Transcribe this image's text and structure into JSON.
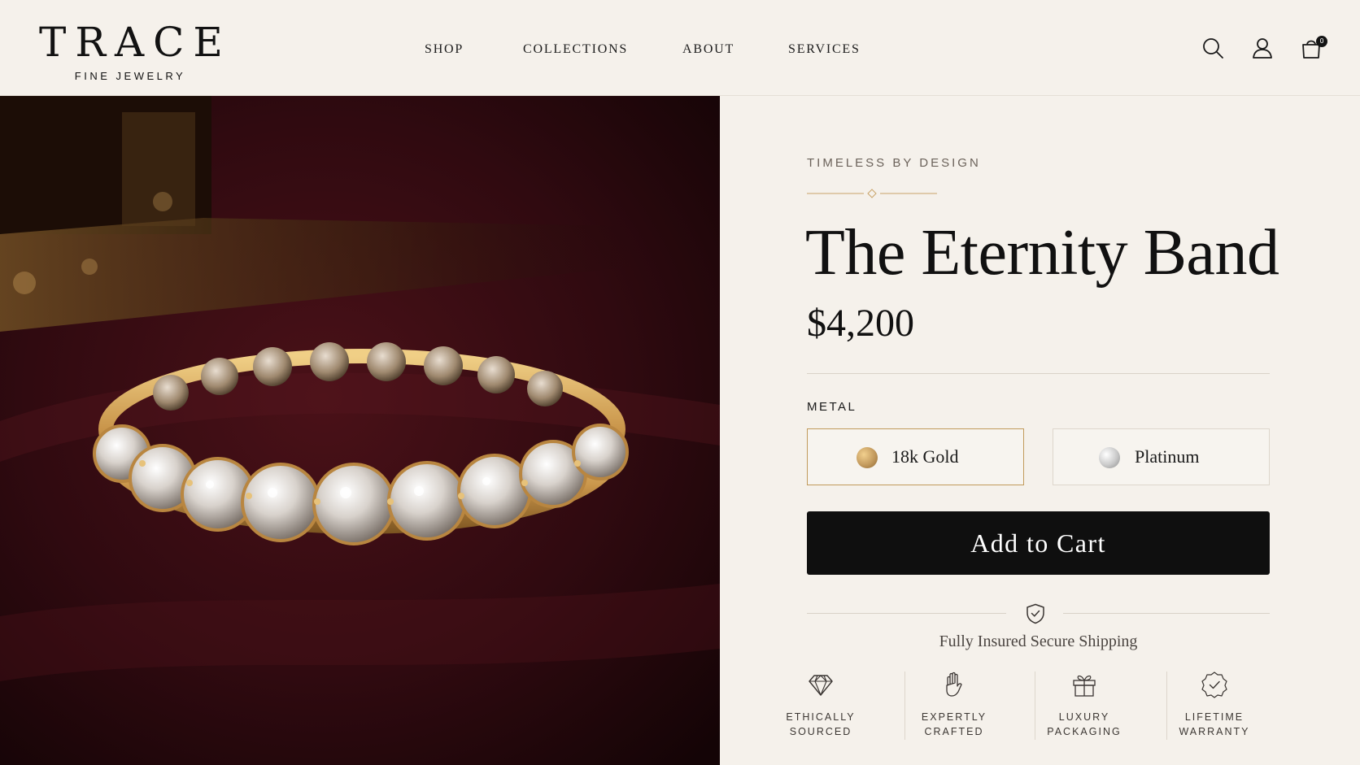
{
  "brand": {
    "name": "TRACE",
    "tagline": "FINE JEWELRY"
  },
  "nav": {
    "items": [
      {
        "label": "SHOP"
      },
      {
        "label": "COLLECTIONS"
      },
      {
        "label": "ABOUT"
      },
      {
        "label": "SERVICES"
      }
    ]
  },
  "header_icons": {
    "search": "search-icon",
    "account": "user-icon",
    "cart": "shopping-bag-icon",
    "cart_count": "0"
  },
  "product": {
    "eyebrow": "TIMELESS BY DESIGN",
    "title": "The Eternity Band",
    "price": "$4,200",
    "metal_label": "METAL",
    "metal_options": [
      {
        "label": "18k Gold",
        "selected": true,
        "swatch_color": "#c39a5e"
      },
      {
        "label": "Platinum",
        "selected": false,
        "swatch_color": "#c9c9c9"
      }
    ],
    "add_to_cart": "Add to Cart"
  },
  "shipping": {
    "icon": "shield-check-icon",
    "text": "Fully Insured Secure Shipping"
  },
  "features": [
    {
      "icon": "diamond-icon",
      "label": "ETHICALLY\nSOURCED"
    },
    {
      "icon": "hand-icon",
      "label": "EXPERTLY\nCRAFTED"
    },
    {
      "icon": "gift-icon",
      "label": "LUXURY\nPACKAGING"
    },
    {
      "icon": "badge-check-icon",
      "label": "LIFETIME\nWARRANTY"
    }
  ],
  "colors": {
    "background": "#f5f1eb",
    "accent_gold": "#c19a5b",
    "button": "#0f0f0f",
    "velvet": "#3a0c12"
  }
}
